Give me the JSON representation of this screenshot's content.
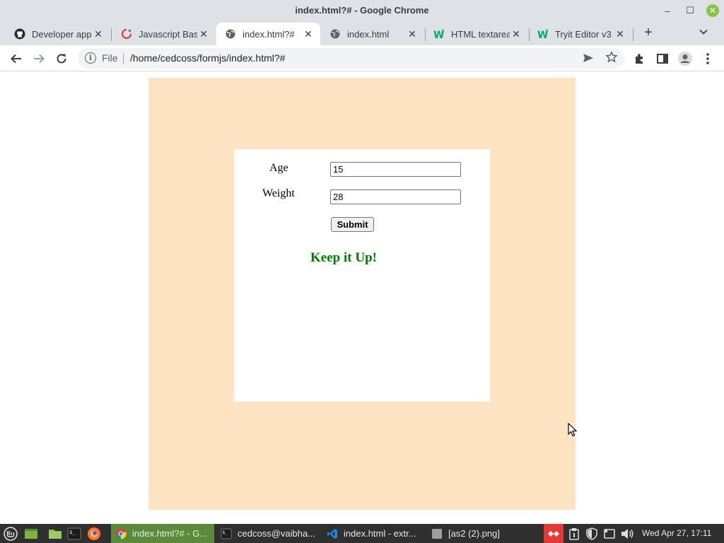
{
  "window": {
    "title": "index.html?# - Google Chrome",
    "minimize": "–",
    "maximize": "☐",
    "close": "✕"
  },
  "tabs": [
    {
      "label": "Developer app",
      "icon": "github-icon"
    },
    {
      "label": "Javascript Bas",
      "icon": "javascript-site-icon"
    },
    {
      "label": "index.html?#",
      "icon": "globe-icon"
    },
    {
      "label": "index.html",
      "icon": "globe-icon"
    },
    {
      "label": "HTML textarea",
      "icon": "w3schools-icon"
    },
    {
      "label": "Tryit Editor v3",
      "icon": "w3schools-icon"
    }
  ],
  "toolbar": {
    "new_tab": "+",
    "tab_search": "⌄",
    "back": "←",
    "forward": "→",
    "reload": "↻",
    "info": "i",
    "file_label": "File",
    "url": "/home/cedcoss/formjs/index.html?#"
  },
  "form": {
    "age_label": "Age",
    "age_value": "15",
    "weight_label": "Weight",
    "weight_value": "28",
    "submit_label": "Submit",
    "result_message": "Keep it Up!"
  },
  "taskbar": {
    "apps": [
      {
        "label": "index.html?# - G...",
        "icon": "chrome-icon",
        "active": true
      },
      {
        "label": "cedcoss@vaibha...",
        "icon": "terminal-icon",
        "active": false
      },
      {
        "label": "index.html - extr...",
        "icon": "vscode-icon",
        "active": false
      },
      {
        "label": "[as2 (2).png]",
        "icon": "image-viewer-icon",
        "active": false
      }
    ],
    "clock": "Wed Apr 27, 17:11"
  },
  "colors": {
    "page_background_box": "#ffe4c4",
    "result_message": "#008000",
    "taskbar_active": "#5a8a3a"
  }
}
